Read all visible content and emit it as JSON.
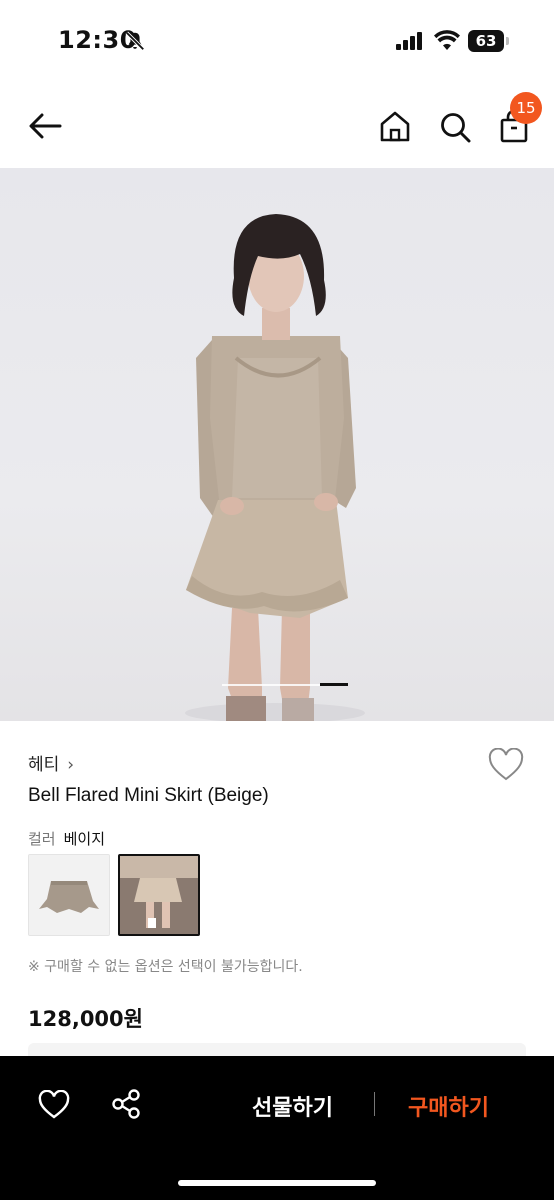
{
  "status_bar": {
    "time": "12:30",
    "battery": "63"
  },
  "header": {
    "cart_count": "15"
  },
  "product": {
    "brand": "헤티",
    "brand_chevron": "›",
    "name": "Bell Flared Mini Skirt (Beige)",
    "option_label": "컬러",
    "option_value": "베이지",
    "notice": "※ 구매할 수 없는 옵션은 선택이 불가능합니다.",
    "price": "128,000원"
  },
  "carousel": {
    "active_index": 2,
    "total": 5
  },
  "bottom_bar": {
    "gift_label": "선물하기",
    "buy_label": "구매하기"
  },
  "colors": {
    "accent": "#f2571f",
    "bottom_bar_bg": "#000000"
  },
  "icons": [
    "bell-off-icon",
    "signal-icon",
    "wifi-icon",
    "battery-icon",
    "back-arrow-icon",
    "home-icon",
    "search-icon",
    "shopping-bag-icon",
    "heart-icon",
    "share-icon"
  ]
}
